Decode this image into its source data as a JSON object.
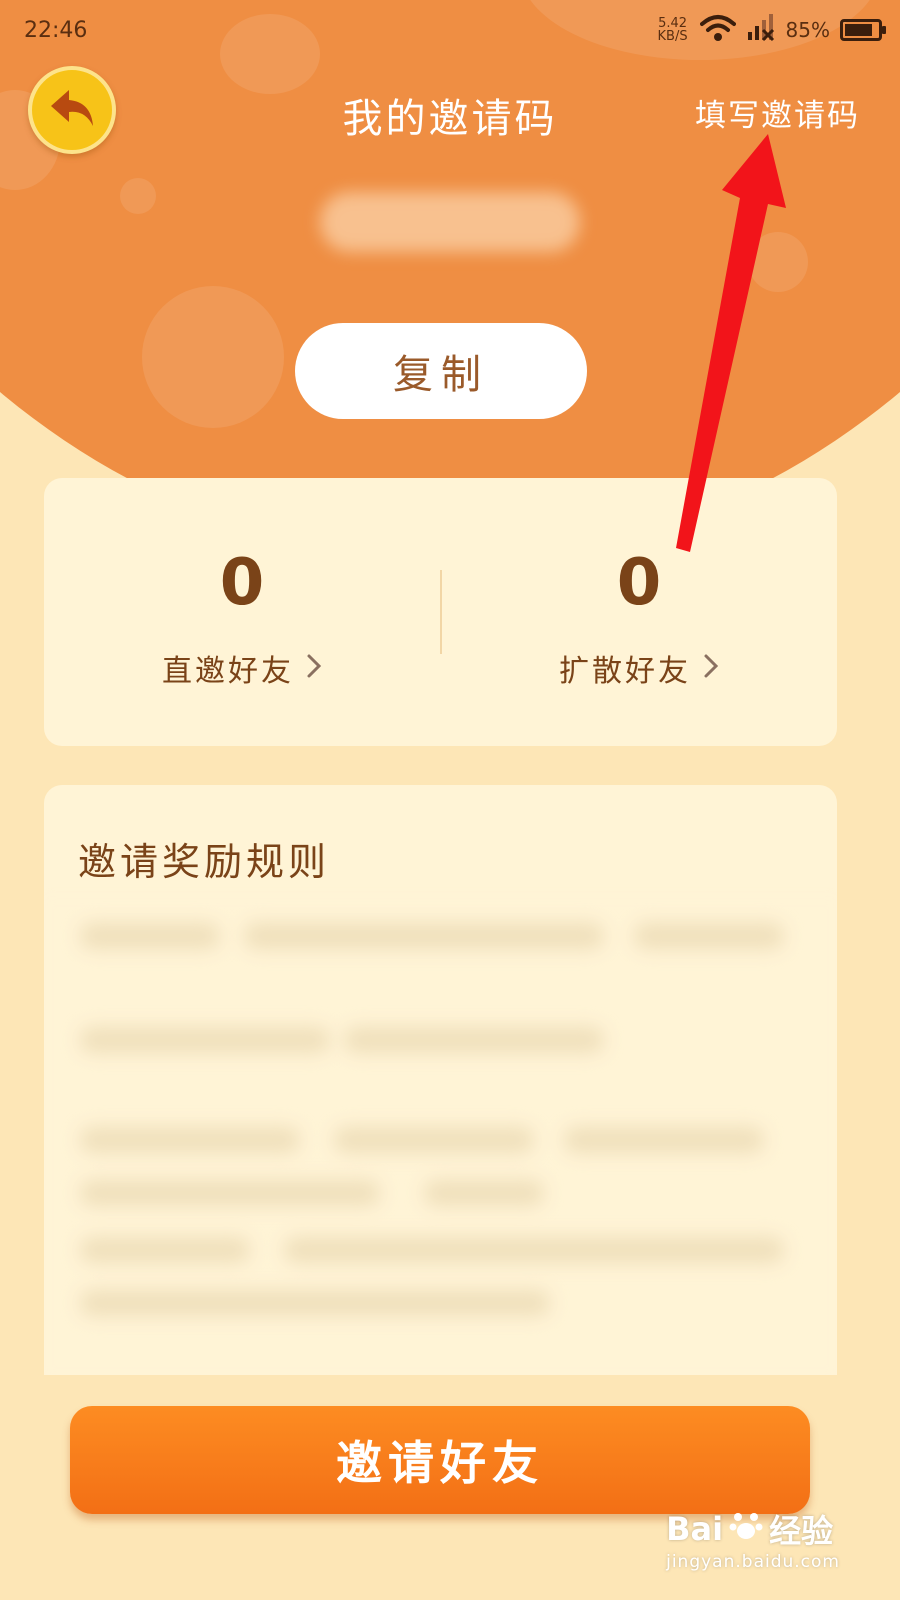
{
  "status_bar": {
    "time": "22:46",
    "net_speed_value": "5.42",
    "net_speed_unit": "KB/S",
    "battery_percent": "85%",
    "battery_level": 0.85
  },
  "header": {
    "title": "我的邀请码",
    "fill_code_link": "填写邀请码"
  },
  "copy_button_label": "复制",
  "stats": {
    "direct": {
      "value": "0",
      "label": "直邀好友"
    },
    "spread": {
      "value": "0",
      "label": "扩散好友"
    }
  },
  "rules": {
    "title": "邀请奖励规则"
  },
  "invite_button_label": "邀请好友",
  "watermark": {
    "brand_main": "Bai",
    "brand_suffix": "经验",
    "url": "jingyan.baidu.com"
  },
  "colors": {
    "header_orange": "#ef8e43",
    "page_bg": "#fde6b6",
    "card_bg": "#fff4d6",
    "text_brown": "#7a4318",
    "annotation_red": "#f2141a"
  },
  "icons": {
    "back": "back-arrow-icon",
    "chevron": "chevron-right-icon",
    "wifi": "wifi-icon",
    "signal": "signal-icon",
    "battery": "battery-icon"
  }
}
